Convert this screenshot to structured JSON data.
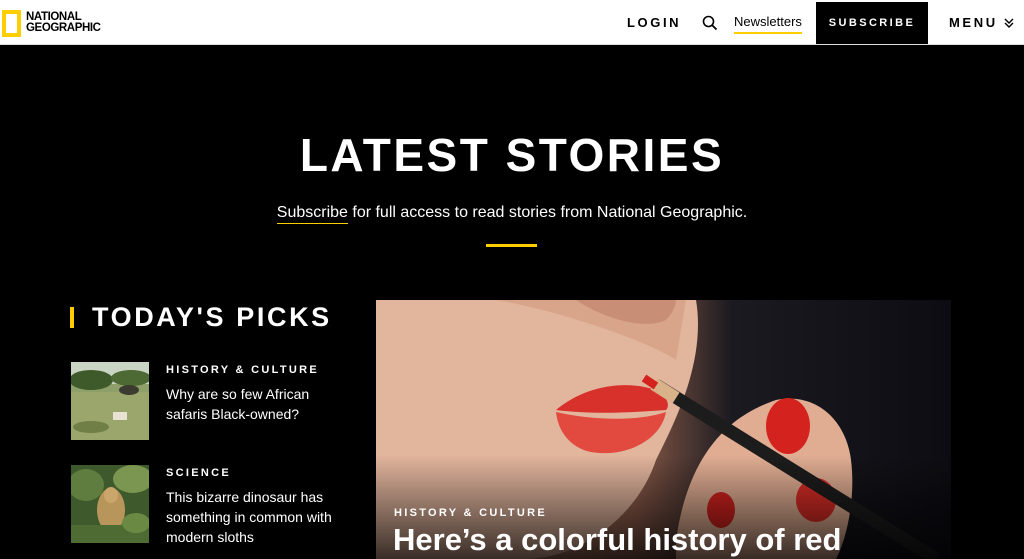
{
  "header": {
    "logo_line1": "NATIONAL",
    "logo_line2": "GEOGRAPHIC",
    "login_label": "LOGIN",
    "search_icon": "search-icon",
    "newsletters_label": "Newsletters",
    "subscribe_label": "SUBSCRIBE",
    "menu_label": "MENU",
    "menu_icon": "chevron-down-icon"
  },
  "hero": {
    "title": "LATEST STORIES",
    "subscribe_link": "Subscribe",
    "subtitle_rest": " for full access to read stories from National Geographic."
  },
  "picks": {
    "heading": "TODAY'S PICKS",
    "items": [
      {
        "category": "HISTORY & CULTURE",
        "title": "Why are so few African safaris Black-owned?"
      },
      {
        "category": "SCIENCE",
        "title": "This bizarre dinosaur has something in common with modern sloths"
      }
    ]
  },
  "feature": {
    "category": "HISTORY & CULTURE",
    "title": "Here’s a colorful history of red"
  },
  "colors": {
    "accent": "#ffce00",
    "background": "#000000",
    "header_bg": "#ffffff"
  }
}
